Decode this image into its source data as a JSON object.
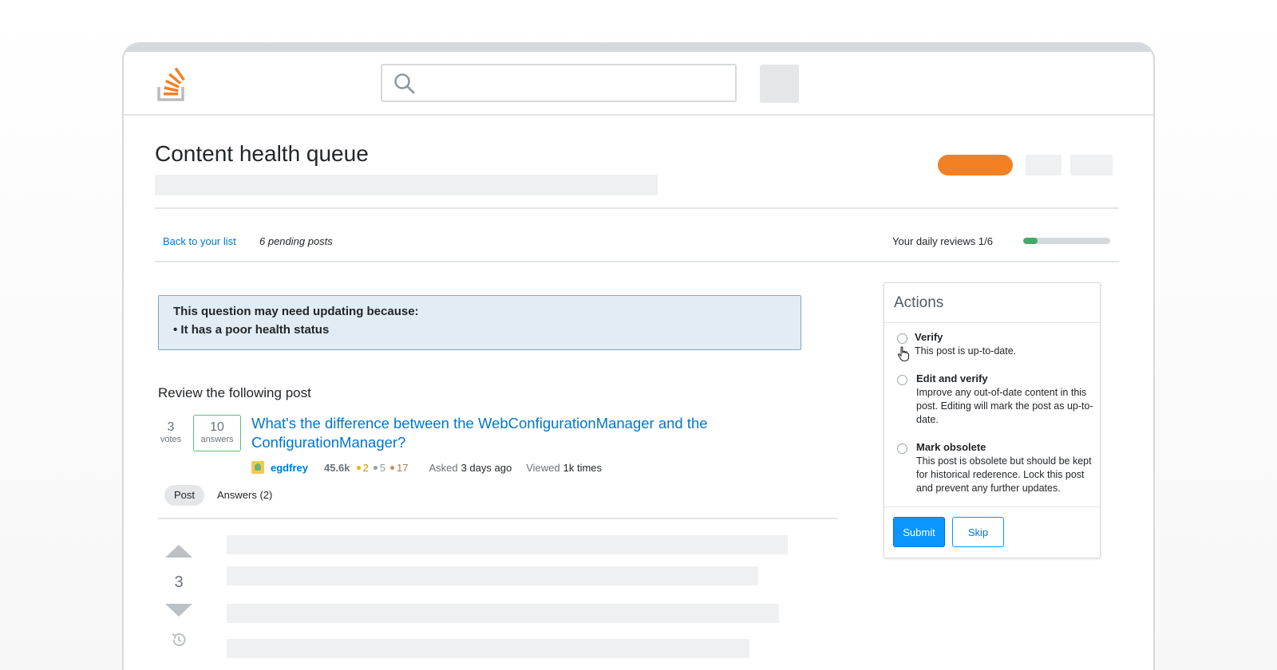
{
  "page": {
    "title": "Content health queue",
    "back_link": "Back to your list",
    "pending": "6 pending posts",
    "daily_reviews": "Your daily reviews 1/6",
    "daily_progress_fraction": 0.1667
  },
  "notice": {
    "heading": "This question may need updating because:",
    "reason": "• It has a poor health status"
  },
  "review": {
    "heading": "Review the following post"
  },
  "question": {
    "votes": "3",
    "votes_label": "votes",
    "answers": "10",
    "answers_label": "answers",
    "title": "What's the difference between the WebConfigurationManager and the ConfigurationManager?",
    "user": "egdfrey",
    "reputation": "45.6k",
    "badges": {
      "gold": "2",
      "silver": "5",
      "bronze": "17"
    },
    "asked_label": "Asked",
    "asked_value": "3 days ago",
    "viewed_label": "Viewed",
    "viewed_value": "1k times"
  },
  "tabs": {
    "post": "Post",
    "answers": "Answers (2)"
  },
  "post": {
    "score": "3"
  },
  "actions": {
    "heading": "Actions",
    "options": [
      {
        "title": "Verify",
        "desc": "This post is up-to-date."
      },
      {
        "title": "Edit and verify",
        "desc": "Improve any out-of-date content in this post. Editing will mark the post as up-to-date."
      },
      {
        "title": "Mark obsolete",
        "desc": "This post is obsolete but should be kept for historical rederence. Lock this post and prevent any further updates."
      }
    ],
    "submit": "Submit",
    "skip": "Skip"
  },
  "icons": {
    "logo": "stack-overflow-logo",
    "search": "search-icon",
    "history": "history-icon",
    "cursor": "hand-pointer-icon"
  },
  "colors": {
    "brand_orange": "#f48024",
    "link_blue": "#0077cc",
    "primary_button": "#0a95ff",
    "progress_green": "#48a868",
    "notice_bg": "#e1ecf4"
  }
}
